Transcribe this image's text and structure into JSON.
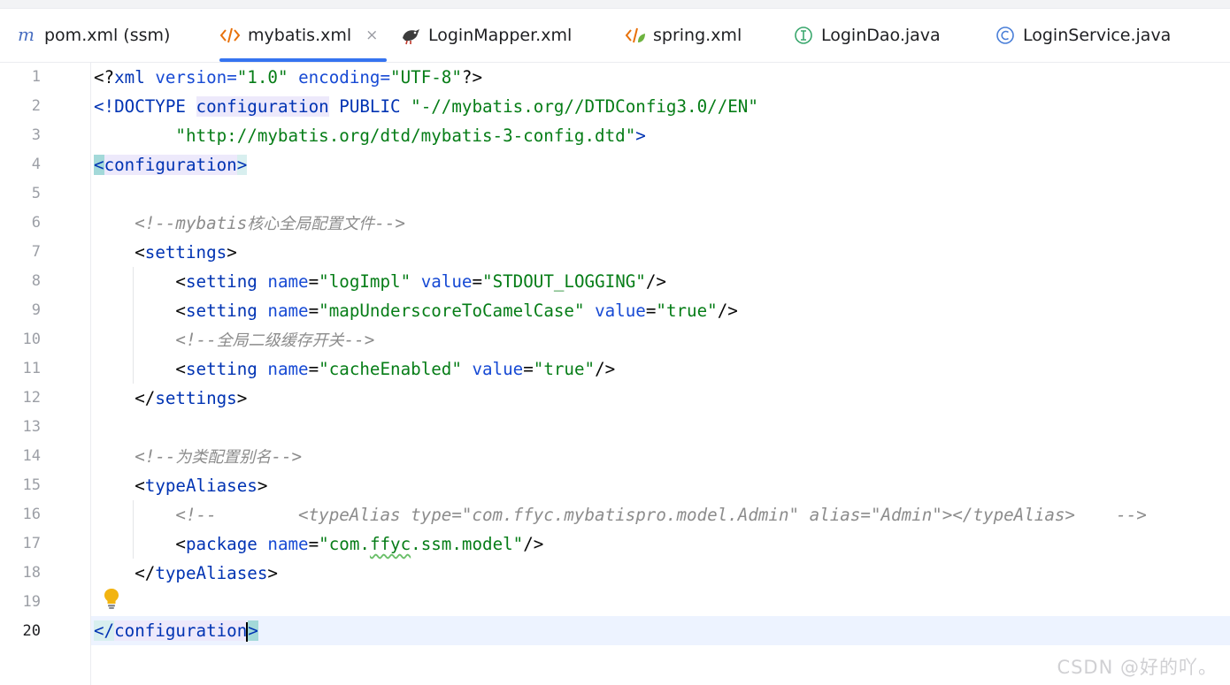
{
  "tabs": [
    {
      "label": "pom.xml (ssm)",
      "icon": "maven-m-icon",
      "active": false
    },
    {
      "label": "mybatis.xml",
      "icon": "xml-code-icon",
      "active": true,
      "closable": true
    },
    {
      "label": "LoginMapper.xml",
      "icon": "mybatis-bird-icon",
      "active": false
    },
    {
      "label": "spring.xml",
      "icon": "spring-xml-icon",
      "active": false
    },
    {
      "label": "LoginDao.java",
      "icon": "interface-i-icon",
      "active": false
    },
    {
      "label": "LoginService.java",
      "icon": "class-c-icon",
      "active": false
    }
  ],
  "tab_close_glyph": "×",
  "line_numbers": [
    "1",
    "2",
    "3",
    "4",
    "5",
    "6",
    "7",
    "8",
    "9",
    "10",
    "11",
    "12",
    "13",
    "14",
    "15",
    "16",
    "17",
    "18",
    "19",
    "20"
  ],
  "active_line": "20",
  "code": {
    "l1": {
      "a": "<?",
      "b": "xml",
      "c": " version",
      "d": "=",
      "e": "\"1.0\"",
      "f": " encoding",
      "g": "=",
      "h": "\"UTF-8\"",
      "i": "?>"
    },
    "l2": {
      "a": "<!DOCTYPE ",
      "b": "configuration",
      "c": " PUBLIC ",
      "d": "\"-//mybatis.org//DTDConfig3.0//EN\""
    },
    "l3": {
      "a": "        \"http://mybatis.org/dtd/mybatis-3-config.dtd\"",
      "b": ">"
    },
    "l4": {
      "a": "<",
      "b": "configuration",
      "c": ">"
    },
    "l6": {
      "a": "    <!--mybatis",
      "b": "核心全局配置文件",
      "c": "-->"
    },
    "l7": {
      "a": "    <",
      "b": "settings",
      "c": ">"
    },
    "l8": {
      "a": "        <",
      "b": "setting",
      "c": " name",
      "d": "=",
      "e": "\"logImpl\"",
      "f": " value",
      "g": "=",
      "h": "\"STDOUT_LOGGING\"",
      "i": "/>"
    },
    "l9": {
      "a": "        <",
      "b": "setting",
      "c": " name",
      "d": "=",
      "e": "\"mapUnderscoreToCamelCase\"",
      "f": " value",
      "g": "=",
      "h": "\"true\"",
      "i": "/>"
    },
    "l10": {
      "a": "        <!--",
      "b": "全局二级缓存开关",
      "c": "-->"
    },
    "l11": {
      "a": "        <",
      "b": "setting",
      "c": " name",
      "d": "=",
      "e": "\"cacheEnabled\"",
      "f": " value",
      "g": "=",
      "h": "\"true\"",
      "i": "/>"
    },
    "l12": {
      "a": "    </",
      "b": "settings",
      "c": ">"
    },
    "l14": {
      "a": "    <!--",
      "b": "为类配置别名",
      "c": "-->"
    },
    "l15": {
      "a": "    <",
      "b": "typeAliases",
      "c": ">"
    },
    "l16": {
      "a": "        <!--        <typeAlias type=\"com.ffyc.mybatispro.model.Admin\" alias=\"Admin\"></typeAlias>    -->"
    },
    "l17": {
      "a": "        <",
      "b": "package",
      "c": " name",
      "d": "=",
      "e": "\"com.",
      "f": "ffyc",
      "g": ".ssm.model\"",
      "h": "/>"
    },
    "l18": {
      "a": "    </",
      "b": "typeAliases",
      "c": ">"
    },
    "l20": {
      "a": "</",
      "b": "configuration",
      "c": ">"
    }
  },
  "watermark": "CSDN @好的吖。",
  "colors": {
    "tag": "#0033b3",
    "attribute": "#174ad4",
    "string": "#067d17",
    "comment": "#8c8c8c",
    "active_tab_underline": "#3574f0",
    "current_line_bg": "#edf3ff",
    "brace_match": "#a3d9d9"
  }
}
